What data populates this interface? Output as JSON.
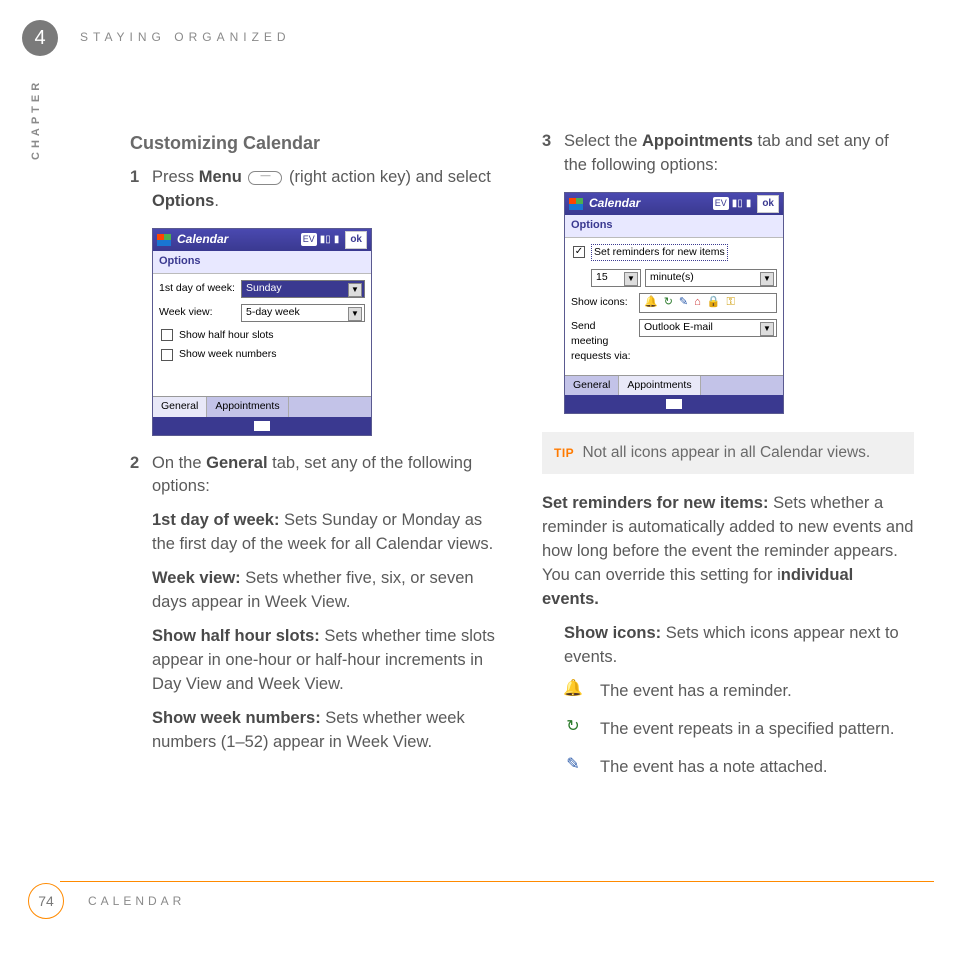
{
  "header": {
    "chapter_number": "4",
    "chapter_subject": "STAYING ORGANIZED",
    "sideways_label": "CHAPTER"
  },
  "footer": {
    "page_number": "74",
    "section_label": "CALENDAR"
  },
  "left": {
    "heading": "Customizing Calendar",
    "step1_num": "1",
    "step1_a": "Press ",
    "step1_b": "Menu",
    "step1_c": " (right action key) and select ",
    "step1_d": "Options",
    "step1_e": ".",
    "step2_num": "2",
    "step2_a": "On the ",
    "step2_b": "General",
    "step2_c": " tab, set any of the following options:",
    "opt1_label": "1st day of week:",
    "opt1_text": " Sets Sunday or Monday as the first day of the week for all Calendar views.",
    "opt2_label": "Week view:",
    "opt2_text": " Sets whether five, six, or seven days appear in Week View.",
    "opt3_label": "Show half hour slots:",
    "opt3_text": " Sets whether time slots appear in one-hour or half-hour increments in Day View and Week View.",
    "opt4_label": "Show week numbers:",
    "opt4_text": " Sets whether week numbers (1–52) appear in Week View."
  },
  "right": {
    "step3_num": "3",
    "step3_a": "Select the ",
    "step3_b": "Appointments",
    "step3_c": " tab and set any of the following options:",
    "tip_label": "TIP",
    "tip_text": " Not all icons appear in all Calendar views.",
    "body1_a": "Set reminders for new items:",
    "body1_b": " Sets whether a reminder is automatically added to new events and how long before the event the reminder appears. You can override this setting for i",
    "body1_c": "ndividual events.",
    "body2_a": "Show icons:",
    "body2_b": " Sets which icons appear next to events.",
    "icon1": "The event has a reminder.",
    "icon2": "The event repeats in a specified pattern.",
    "icon3": "The event has a note attached."
  },
  "device1": {
    "title": "Calendar",
    "status_ev": "EV",
    "ok": "ok",
    "subhead": "Options",
    "row1_label": "1st day of week:",
    "row1_value": "Sunday",
    "row2_label": "Week view:",
    "row2_value": "5-day week",
    "chk1": "Show half hour slots",
    "chk2": "Show week numbers",
    "tab1": "General",
    "tab2": "Appointments"
  },
  "device2": {
    "title": "Calendar",
    "status_ev": "EV",
    "ok": "ok",
    "subhead": "Options",
    "chk1": "Set reminders for new items",
    "num_value": "15",
    "unit_value": "minute(s)",
    "row_icons_label": "Show icons:",
    "row_send_label": "Send meeting requests via:",
    "send_value": "Outlook E-mail",
    "tab1": "General",
    "tab2": "Appointments"
  }
}
